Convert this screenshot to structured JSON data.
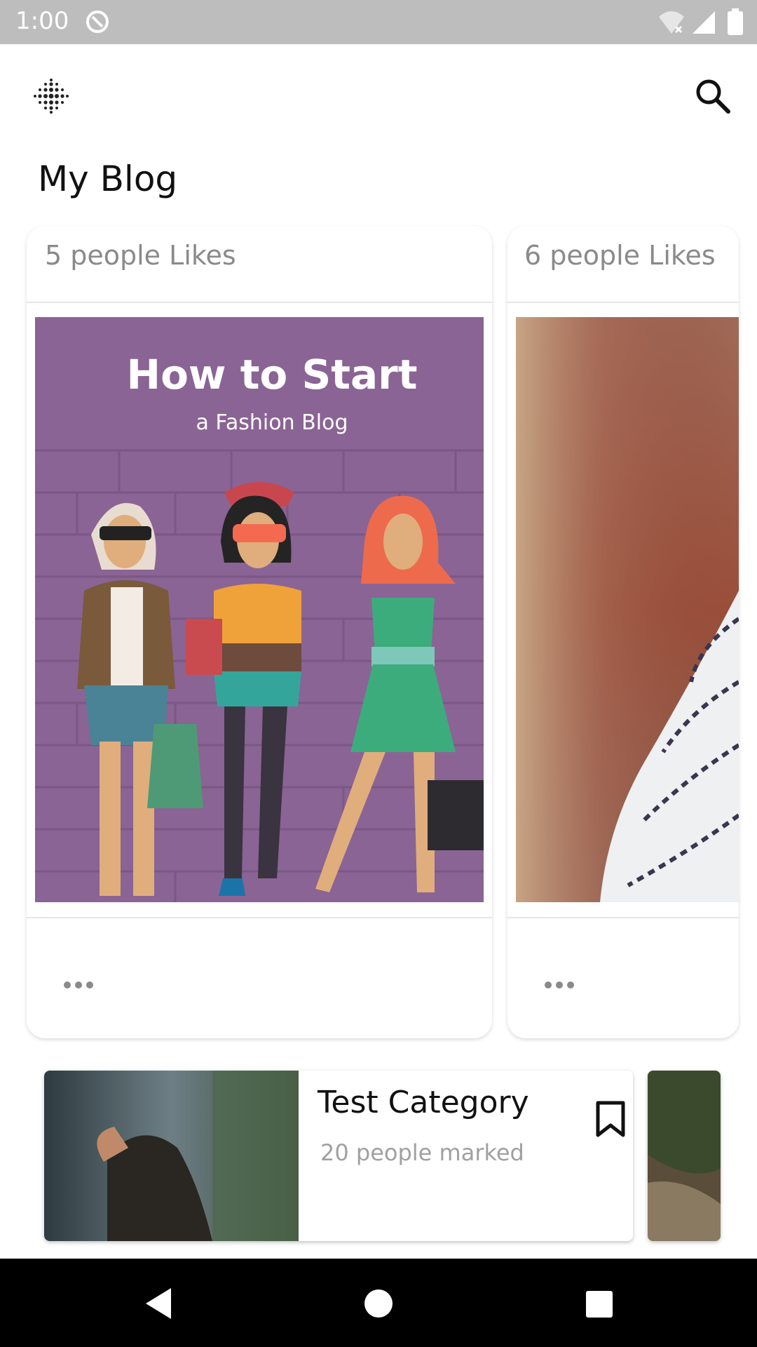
{
  "status_bar": {
    "time": "1:00",
    "icons": [
      "sync-icon",
      "wifi-off-icon",
      "signal-icon",
      "battery-icon"
    ]
  },
  "header": {
    "menu_icon": "dots-grid-icon",
    "search_icon": "search-icon",
    "title": "My Blog"
  },
  "blog_cards": [
    {
      "likes": "5 people Likes",
      "image": {
        "title": "How to Start",
        "subtitle": "a Fashion Blog",
        "bg_color": "#8a6494"
      },
      "more_icon": "more-horizontal-icon"
    },
    {
      "likes": "6 people Likes",
      "image": {
        "bg_color": "#a06a58"
      },
      "more_icon": "more-horizontal-icon"
    }
  ],
  "categories": [
    {
      "title": "Test Category",
      "subtitle": "20 people marked",
      "bookmark_icon": "bookmark-icon"
    }
  ],
  "nav_bar": {
    "buttons": [
      "back-icon",
      "home-icon",
      "recents-icon"
    ]
  },
  "colors": {
    "status_bar": "#bdbdbd",
    "title_text": "#111111",
    "secondary_text": "#8a8a8a",
    "nav_bar": "#000000"
  }
}
